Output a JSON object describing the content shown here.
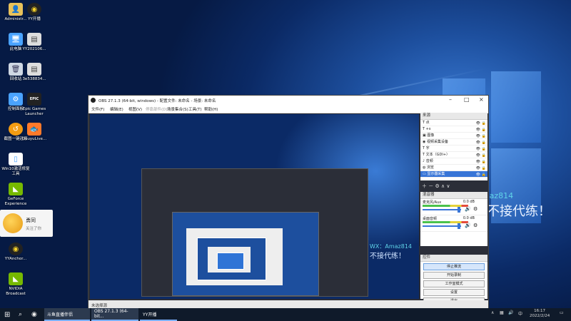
{
  "desktop_icons": [
    {
      "label": "Administr...",
      "icon": "user-folder-icon",
      "color": "#e8c15a"
    },
    {
      "label": "YY开播",
      "icon": "yy-icon",
      "color": "#f5d12a"
    },
    {
      "label": "此电脑",
      "icon": "computer-icon",
      "color": "#4aa3ff"
    },
    {
      "label": "YY202106...",
      "icon": "image-file-icon",
      "color": "#dddddd"
    },
    {
      "label": "回收站",
      "icon": "recycle-bin-icon",
      "color": "#cfd8e3"
    },
    {
      "label": "3e538834...",
      "icon": "image-file-icon",
      "color": "#dddddd"
    },
    {
      "label": "控制面板",
      "icon": "control-panel-icon",
      "color": "#4aa3ff"
    },
    {
      "label": "Epic Games Launcher",
      "icon": "epic-icon",
      "color": "#222222"
    },
    {
      "label": "截图一键还原",
      "icon": "restore-icon",
      "color": "#f39c12"
    },
    {
      "label": "DouyuLive...",
      "icon": "douyu-icon",
      "color": "#ff7a2a"
    },
    {
      "label": "Win10激活修复工具",
      "icon": "file-icon",
      "color": "#ffffff"
    },
    {
      "label": "GeForce Experience",
      "icon": "nvidia-icon",
      "color": "#76b900"
    },
    {
      "label": "YYAnchor...",
      "icon": "yy-icon",
      "color": "#f5d12a"
    },
    {
      "label": "NVIDIA Broadcast",
      "icon": "nvidia-icon",
      "color": "#76b900"
    }
  ],
  "notification": {
    "name": "勇同",
    "status": "关注了你"
  },
  "obs": {
    "title": "OBS 27.1.3 (64-bit, windows) - 配置文件: 未命名 - 场景: 未命名",
    "menu": [
      "文件(F)",
      "编辑(E)",
      "视图(V)",
      "停靠部件(D)",
      "场景集合(S)",
      "工具(T)",
      "帮助(H)"
    ],
    "sources_title": "来源",
    "sources": [
      {
        "name": "点",
        "icon": "T"
      },
      {
        "name": "+s",
        "icon": "T"
      },
      {
        "name": "图像",
        "icon": "▣"
      },
      {
        "name": "视频采集设备",
        "icon": "◉"
      },
      {
        "name": "字",
        "icon": "T"
      },
      {
        "name": "文本（GDI+）",
        "icon": "T"
      },
      {
        "name": "音频",
        "icon": "♪"
      },
      {
        "name": "浏览",
        "icon": "◍"
      },
      {
        "name": "显示器采集",
        "icon": "▭"
      }
    ],
    "mixer_title": "混音器",
    "mixer": [
      {
        "name": "麦克风/Aux",
        "db": "0.0 dB"
      },
      {
        "name": "桌面音频",
        "db": "0.0 dB"
      }
    ],
    "controls_title": "控件",
    "controls": [
      "停止推流",
      "开始录制",
      "工作室模式",
      "设置",
      "退出"
    ],
    "status_left": "未选择源"
  },
  "watermark": {
    "wx": "WX：Amaz814",
    "slogan": "不接代练！"
  },
  "taskbar": {
    "items": [
      {
        "label": "斗鱼直播伴侣"
      },
      {
        "label": "OBS 27.1.3 (64-bit..."
      },
      {
        "label": "YY开播"
      }
    ],
    "time": "16:17",
    "date": "2022/2/24",
    "ime": "中"
  },
  "colors": {
    "accent": "#3875d7",
    "taskbar": "#0f1a2a",
    "watermark_cyan": "#5fd3e8"
  }
}
